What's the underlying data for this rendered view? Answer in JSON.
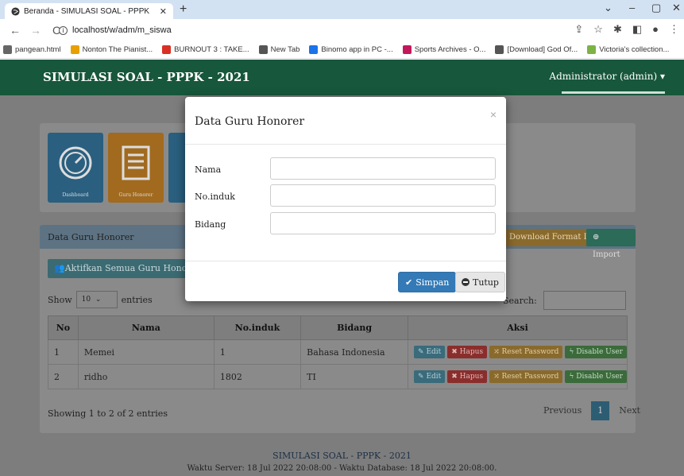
{
  "browser": {
    "tab_title": "Beranda - SIMULASI SOAL - PPPK",
    "tab_close": "✕",
    "new_tab": "+",
    "url": "localhost/w/adm/m_siswa",
    "window_controls": [
      "⌄",
      "–",
      "▢",
      "✕"
    ],
    "bookmarks": [
      {
        "label": "pangean.html",
        "color": "#666666"
      },
      {
        "label": "Nonton The Pianist...",
        "color": "#e8a000"
      },
      {
        "label": "BURNOUT 3 : TAKE...",
        "color": "#d93025"
      },
      {
        "label": "New Tab",
        "color": "#555555"
      },
      {
        "label": "Binomo app in PC -...",
        "color": "#1a73e8"
      },
      {
        "label": "Sports Archives - O...",
        "color": "#c2185b"
      },
      {
        "label": "[Download] God Of...",
        "color": "#555555"
      },
      {
        "label": "Victoria's collection...",
        "color": "#7cb342"
      }
    ]
  },
  "app": {
    "brand": "SIMULASI SOAL - PPPK - 2021",
    "user_menu": "Administrator (admin) ▾",
    "tiles": [
      {
        "label": "Dashboard",
        "color": "#2a5f7f"
      },
      {
        "label": "Guru Honorer",
        "color": "#a16a1e"
      },
      {
        "label": "",
        "color": "#2a5f7f"
      }
    ],
    "panel_title": "Data Guru Honorer",
    "download_btn": "Download Format Import",
    "import_btn": "⊕ Import",
    "activate_btn": "Aktifkan Semua Guru Honorer",
    "show_label": "Show",
    "entries_value": "10",
    "entries_label": "entries",
    "search_label": "Search:",
    "table": {
      "headers": [
        "No",
        "Nama",
        "No.induk",
        "Bidang",
        "Aksi"
      ],
      "rows": [
        {
          "no": "1",
          "nama": "Memei",
          "induk": "1",
          "bidang": "Bahasa Indonesia"
        },
        {
          "no": "2",
          "nama": "ridho",
          "induk": "1802",
          "bidang": "TI"
        }
      ],
      "actions": {
        "edit": "Edit",
        "hapus": "Hapus",
        "reset": "Reset Password",
        "disable": "Disable User"
      }
    },
    "showing": "Showing 1 to 2 of 2 entries",
    "pager": {
      "prev": "Previous",
      "page": "1",
      "next": "Next"
    },
    "footer_title": "SIMULASI SOAL - PPPK - 2021",
    "footer_time": "Waktu Server: 18 Jul 2022 20:08:00 - Waktu Database: 18 Jul 2022 20:08:00."
  },
  "modal": {
    "title": "Data Guru Honorer",
    "close": "×",
    "fields": [
      {
        "label": "Nama",
        "value": ""
      },
      {
        "label": "No.induk",
        "value": ""
      },
      {
        "label": "Bidang",
        "value": ""
      }
    ],
    "save_btn": "Simpan",
    "close_btn": "Tutup"
  }
}
